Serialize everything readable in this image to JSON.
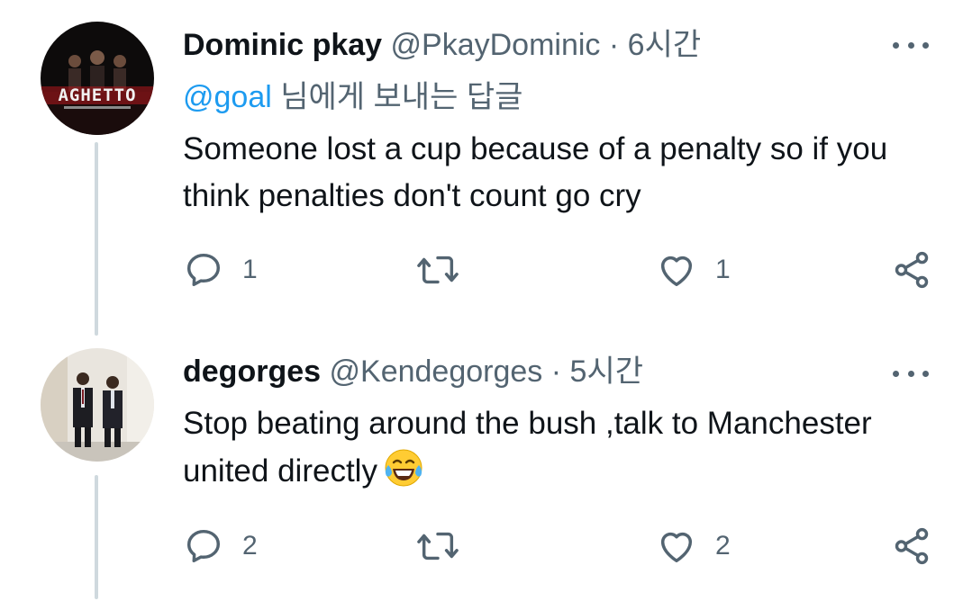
{
  "tweets": [
    {
      "display_name": "Dominic pkay",
      "handle": "@PkayDominic",
      "separator": "·",
      "time": "6시간",
      "reply_to": {
        "mention": "@goal",
        "suffix": " 님에게 보내는 답글"
      },
      "text": "Someone lost a cup because of a penalty so if you think penalties don't count go cry",
      "avatar_label": "AGHETTO",
      "reply_count": "1",
      "retweet_count": "",
      "like_count": "1"
    },
    {
      "display_name": "degorges",
      "handle": "@Kendegorges",
      "separator": "·",
      "time": "5시간",
      "text": "Stop beating around the bush ,talk to Manchester united directly",
      "emoji": "face-with-tears-of-joy",
      "reply_count": "2",
      "retweet_count": "",
      "like_count": "2"
    }
  ],
  "icons": {
    "reply": "reply-icon",
    "retweet": "retweet-icon",
    "like": "heart-icon",
    "share": "share-icon",
    "more": "more-icon"
  },
  "colors": {
    "text": "#0f1419",
    "secondary": "#536471",
    "link": "#1d9bf0",
    "thread_line": "#cfd9de"
  }
}
